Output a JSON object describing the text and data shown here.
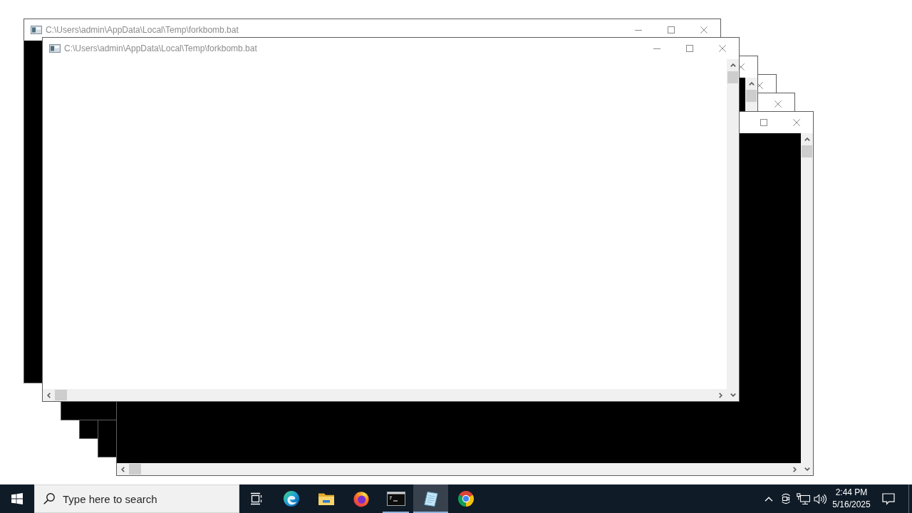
{
  "windows": [
    {
      "title": "C:\\Users\\admin\\AppData\\Local\\Temp\\forkbomb.bat",
      "kind": "console",
      "horizontal_scrollbar": false
    },
    {
      "title": "C:\\Users\\admin\\AppData\\Local\\Temp\\forkbomb.bat",
      "kind": "blank",
      "vertical_scrollbar": true,
      "horizontal_scrollbar": true
    },
    {
      "kind": "console",
      "vertical_scrollbar": true,
      "horizontal_scrollbar": false
    },
    {
      "kind": "console",
      "horizontal_scrollbar": false
    },
    {
      "kind": "console",
      "horizontal_scrollbar": false
    },
    {
      "kind": "console",
      "vertical_scrollbar": true,
      "horizontal_scrollbar": true
    }
  ],
  "taskbar": {
    "search": {
      "placeholder": "Type here to search"
    },
    "apps": [
      {
        "running": false,
        "active": false
      },
      {
        "running": false,
        "active": false
      },
      {
        "running": false,
        "active": false
      },
      {
        "running": true,
        "active": false
      },
      {
        "running": true,
        "active": true
      },
      {
        "running": false,
        "active": false
      }
    ],
    "clock": {
      "time": "2:44 PM",
      "date": "5/16/2025"
    }
  }
}
